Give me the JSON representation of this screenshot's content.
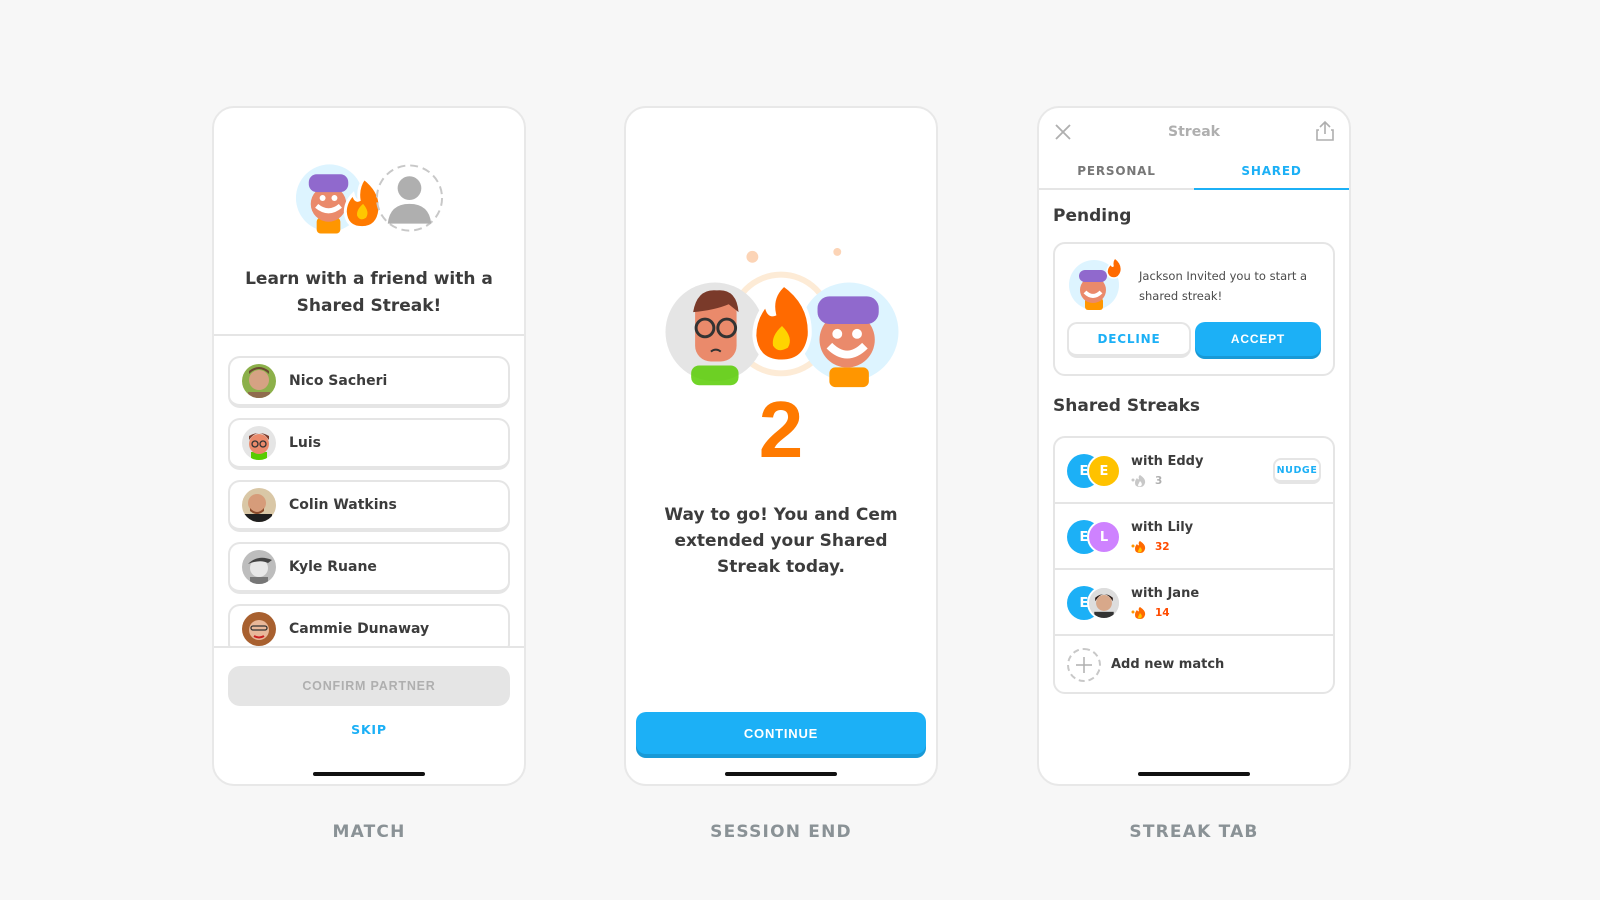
{
  "screens": {
    "match": {
      "caption": "MATCH",
      "title": "Learn with a friend with a Shared Streak!",
      "friends": [
        {
          "name": "Nico Sacheri"
        },
        {
          "name": "Luis"
        },
        {
          "name": "Colin Watkins"
        },
        {
          "name": "Kyle Ruane"
        },
        {
          "name": "Cammie Dunaway"
        }
      ],
      "confirm_label": "CONFIRM PARTNER",
      "skip_label": "SKIP"
    },
    "session_end": {
      "caption": "SESSION END",
      "streak_count": "2",
      "message": "Way to go! You and Cem extended your Shared Streak today.",
      "continue_label": "CONTINUE"
    },
    "streak_tab": {
      "caption": "STREAK TAB",
      "title": "Streak",
      "tabs": [
        {
          "label": "PERSONAL"
        },
        {
          "label": "SHARED"
        }
      ],
      "active_tab": "SHARED",
      "pending_heading": "Pending",
      "pending": {
        "message": "Jackson Invited you to start a shared streak!",
        "decline_label": "DECLINE",
        "accept_label": "ACCEPT"
      },
      "shared_heading": "Shared Streaks",
      "streaks": [
        {
          "label": "with Eddy",
          "my_initial": "E",
          "partner_initial": "E",
          "count": "3",
          "active": false,
          "partner_color": "#ffc200",
          "action": "NUDGE"
        },
        {
          "label": "with Lily",
          "my_initial": "E",
          "partner_initial": "L",
          "count": "32",
          "active": true,
          "partner_color": "#ce82ff"
        },
        {
          "label": "with Jane",
          "my_initial": "E",
          "partner_initial": "",
          "count": "14",
          "active": true,
          "partner_color": "#8a6a5a"
        }
      ],
      "add_label": "Add new match"
    }
  },
  "colors": {
    "accent": "#1cb0f6",
    "streak_orange": "#ff7a00",
    "streak_red": "#ff4b00",
    "inactive_gray": "#afafaf"
  }
}
